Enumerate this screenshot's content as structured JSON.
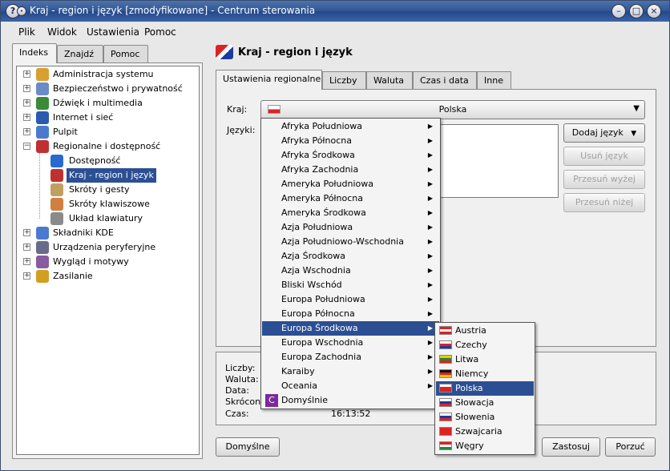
{
  "window": {
    "title": "Kraj - region i język [zmodyfikowane] - Centrum sterowania"
  },
  "menubar": [
    {
      "label": "Plik"
    },
    {
      "label": "Widok"
    },
    {
      "label": "Ustawienia"
    },
    {
      "label": "Pomoc"
    }
  ],
  "left_tabs": [
    {
      "label": "Indeks"
    },
    {
      "label": "Znajdź"
    },
    {
      "label": "Pomoc"
    }
  ],
  "tree": [
    {
      "label": "Administracja systemu",
      "icon": "admin-icon",
      "color": "#d8a030"
    },
    {
      "label": "Bezpieczeństwo i prywatność",
      "icon": "user-icon",
      "color": "#6a8ac8"
    },
    {
      "label": "Dźwięk i multimedia",
      "icon": "sound-icon",
      "color": "#3a8a3a"
    },
    {
      "label": "Internet i sieć",
      "icon": "globe-icon",
      "color": "#2a5ab0"
    },
    {
      "label": "Pulpit",
      "icon": "desktop-icon",
      "color": "#4a7ad0"
    },
    {
      "label": "Regionalne i dostępność",
      "icon": "flag-icon",
      "color": "#c03030"
    },
    {
      "label": "Dostępność",
      "icon": "accessibility-icon",
      "color": "#2a6ad0"
    },
    {
      "label": "Kraj - region i język",
      "icon": "flag-icon",
      "color": "#c03030"
    },
    {
      "label": "Skróty i gesty",
      "icon": "keyboard-icon",
      "color": "#c0a060"
    },
    {
      "label": "Skróty klawiszowe",
      "icon": "shortcut-icon",
      "color": "#d08040"
    },
    {
      "label": "Układ klawiatury",
      "icon": "keyboard-layout-icon",
      "color": "#8a8a8a"
    },
    {
      "label": "Składniki KDE",
      "icon": "kde-icon",
      "color": "#4a7ad0"
    },
    {
      "label": "Urządzenia peryferyjne",
      "icon": "device-icon",
      "color": "#6a6a8a"
    },
    {
      "label": "Wygląd i motywy",
      "icon": "theme-icon",
      "color": "#8a5aa0"
    },
    {
      "label": "Zasilanie",
      "icon": "power-icon",
      "color": "#d0a020"
    }
  ],
  "page": {
    "title": "Kraj - region i język"
  },
  "tabs": [
    {
      "label": "Ustawienia regionalne"
    },
    {
      "label": "Liczby"
    },
    {
      "label": "Waluta"
    },
    {
      "label": "Czas i data"
    },
    {
      "label": "Inne"
    }
  ],
  "form": {
    "country_label": "Kraj:",
    "country_value": "Polska",
    "languages_label": "Języki:"
  },
  "buttons": {
    "add_language": "Dodaj język",
    "remove_language": "Usuń język",
    "move_up": "Przesuń wyżej",
    "move_down": "Przesuń niżej",
    "defaults": "Domyślne",
    "apply": "Zastosuj",
    "discard": "Porzuć"
  },
  "preview": {
    "numbers_label": "Liczby:",
    "currency_label": "Waluta:",
    "date_label": "Data:",
    "short_label": "Skrócona",
    "time_label": "Czas:",
    "time_value": "16:13:52"
  },
  "region_menu": [
    "Afryka Południowa",
    "Afryka Północna",
    "Afryka Środkowa",
    "Afryka Zachodnia",
    "Ameryka Południowa",
    "Ameryka Północna",
    "Ameryka Środkowa",
    "Azja Południowa",
    "Azja Południowo-Wschodnia",
    "Azja Środkowa",
    "Azja Wschodnia",
    "Bliski Wschód",
    "Europa Południowa",
    "Europa Północna",
    "Europa Środkowa",
    "Europa Wschodnia",
    "Europa Zachodnia",
    "Karaiby",
    "Oceania"
  ],
  "region_menu_default": "Domyślnie",
  "country_menu": [
    {
      "label": "Austria",
      "flag": [
        "#d22",
        "#fff",
        "#d22"
      ]
    },
    {
      "label": "Czechy",
      "flag": [
        "#fff",
        "#d22",
        "#1a3aa0"
      ]
    },
    {
      "label": "Litwa",
      "flag": [
        "#f0c800",
        "#1a8a3a",
        "#d22"
      ]
    },
    {
      "label": "Niemcy",
      "flag": [
        "#111",
        "#d22",
        "#f0c800"
      ]
    },
    {
      "label": "Polska",
      "flag": [
        "#fff",
        "#d22",
        "#d22"
      ]
    },
    {
      "label": "Słowacja",
      "flag": [
        "#fff",
        "#1a3aa0",
        "#d22"
      ]
    },
    {
      "label": "Słowenia",
      "flag": [
        "#fff",
        "#1a3aa0",
        "#d22"
      ]
    },
    {
      "label": "Szwajcaria",
      "flag": [
        "#d22",
        "#d22",
        "#d22"
      ]
    },
    {
      "label": "Węgry",
      "flag": [
        "#d22",
        "#fff",
        "#1a8a3a"
      ]
    }
  ]
}
